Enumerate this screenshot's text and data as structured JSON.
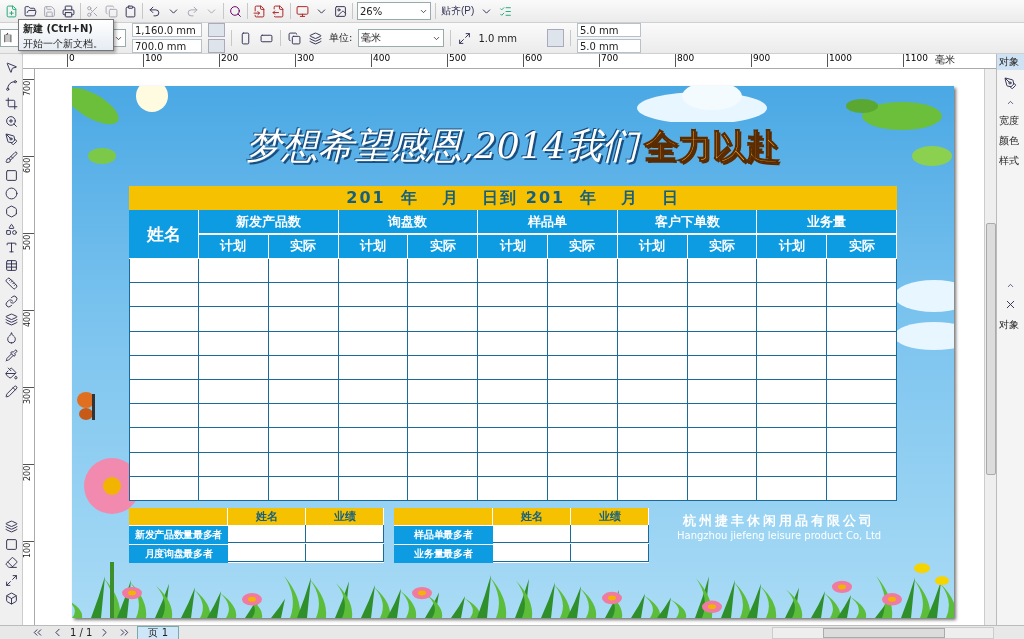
{
  "toolbar": {
    "zoom": "26%",
    "snap": "贴齐(P)"
  },
  "tooltip": {
    "title": "新建 (Ctrl+N)",
    "description": "开始一个新文档。"
  },
  "property_bar": {
    "preset": "自",
    "width": "1,160.0 mm",
    "height": "700.0 mm",
    "units_label": "单位:",
    "units": "毫米",
    "nudge": "1.0 mm",
    "duplicate_x": "5.0 mm",
    "duplicate_y": "5.0 mm"
  },
  "ruler": {
    "h_ticks": [
      "0",
      "100",
      "200",
      "300",
      "400",
      "500",
      "600",
      "700",
      "800",
      "900",
      "1000",
      "1100"
    ],
    "unit": "毫米",
    "v_ticks": [
      "700",
      "600",
      "500",
      "400",
      "300",
      "200",
      "100"
    ]
  },
  "docker": {
    "tab": "对象",
    "fields": [
      "宽度",
      "颜色",
      "样式"
    ],
    "footer": "对象"
  },
  "poster": {
    "title": "梦想希望感恩,2014我们",
    "title_highlight": "全力以赴",
    "date_line": "201  年   月   日到 201  年   月   日",
    "name_header": "姓名",
    "groups": [
      {
        "label": "新发产品数",
        "sub": [
          "计划",
          "实际"
        ]
      },
      {
        "label": "询盘数",
        "sub": [
          "计划",
          "实际"
        ]
      },
      {
        "label": "样品单",
        "sub": [
          "计划",
          "实际"
        ]
      },
      {
        "label": "客户下单数",
        "sub": [
          "计划",
          "实际"
        ]
      },
      {
        "label": "业务量",
        "sub": [
          "计划",
          "实际"
        ]
      }
    ],
    "summary_tables": [
      {
        "headers": [
          "姓名",
          "业绩"
        ],
        "rows": [
          "新发产品数量最多者",
          "月度询盘最多者"
        ]
      },
      {
        "headers": [
          "姓名",
          "业绩"
        ],
        "rows": [
          "样品单最多者",
          "业务量最多者"
        ]
      }
    ],
    "company": "杭州捷丰休闲用品有限公司",
    "company_en": "Hangzhou jiefeng leisure product Co, Ltd"
  },
  "status": {
    "pager": "1 / 1",
    "page_tab": "页 1"
  }
}
